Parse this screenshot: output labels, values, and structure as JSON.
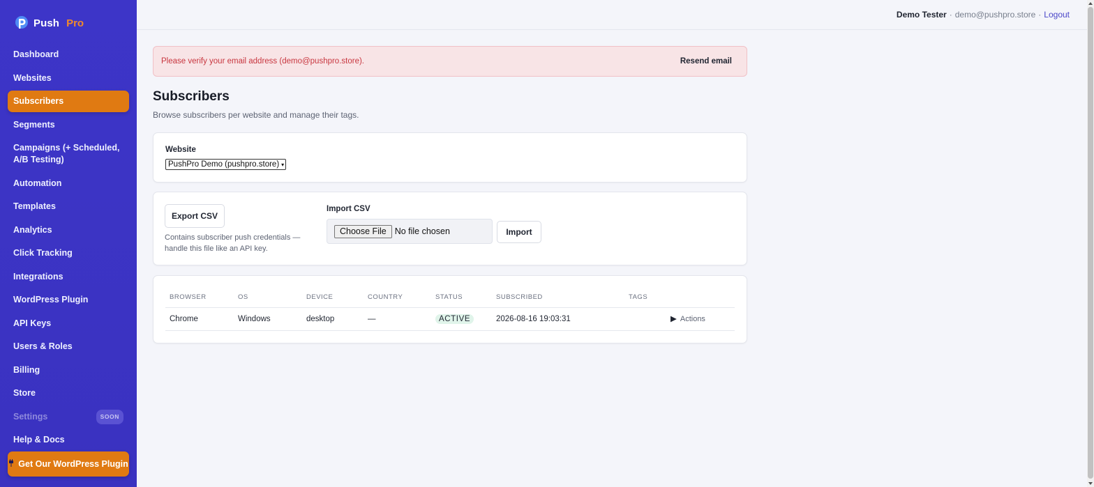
{
  "brand": {
    "name": "Push",
    "suffix": "Pro"
  },
  "sidebar": {
    "items": [
      {
        "label": "Dashboard"
      },
      {
        "label": "Websites"
      },
      {
        "label": "Subscribers",
        "active": true
      },
      {
        "label": "Segments"
      },
      {
        "label": "Campaigns (+ Scheduled, A/B Testing)"
      },
      {
        "label": "Automation"
      },
      {
        "label": "Templates"
      },
      {
        "label": "Analytics"
      },
      {
        "label": "Click Tracking"
      },
      {
        "label": "Integrations"
      },
      {
        "label": "WordPress Plugin"
      },
      {
        "label": "API Keys"
      },
      {
        "label": "Users & Roles"
      },
      {
        "label": "Billing"
      },
      {
        "label": "Store"
      },
      {
        "label": "Settings",
        "badge": "SOON"
      },
      {
        "label": "Help & Docs"
      }
    ],
    "cta_label": "Get Our WordPress Plugin",
    "cta_icon": "plug-icon"
  },
  "topbar": {
    "user_name": "Demo Tester",
    "separator": "·",
    "user_email": "demo@pushpro.store",
    "logout_label": "Logout"
  },
  "alert": {
    "message": "Please verify your email address (demo@pushpro.store).",
    "button_label": "Resend email"
  },
  "page": {
    "title": "Subscribers",
    "subtitle": "Browse subscribers per website and manage their tags."
  },
  "website_filter": {
    "label": "Website",
    "selected": "PushPro Demo (pushpro.store)"
  },
  "io": {
    "export_label": "Export CSV",
    "export_note": "Contains subscriber push credentials — handle this file like an API key.",
    "import_label": "Import CSV",
    "file_button": "Choose File",
    "file_status": "No file chosen",
    "import_button": "Import"
  },
  "table": {
    "headers": [
      "BROWSER",
      "OS",
      "DEVICE",
      "COUNTRY",
      "STATUS",
      "SUBSCRIBED",
      "TAGS"
    ],
    "rows": [
      {
        "browser": "Chrome",
        "os": "Windows",
        "device": "desktop",
        "country": "—",
        "status": "ACTIVE",
        "subscribed": "2026-08-16 19:03:31",
        "tags": "",
        "actions": "Actions"
      }
    ]
  },
  "colors": {
    "sidebar": "#3d35c8",
    "accent": "#e07a12",
    "alert_bg": "#f8e4e6",
    "alert_text": "#c8363f",
    "status_active": "#1e8a57"
  }
}
